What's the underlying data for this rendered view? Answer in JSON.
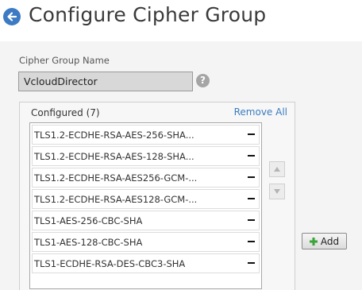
{
  "header": {
    "title": "Configure Cipher Group",
    "back_icon": "back-arrow-icon"
  },
  "form": {
    "name_label": "Cipher Group Name",
    "name_value": "VcloudDirector",
    "help_icon": "help-icon",
    "help_glyph": "?"
  },
  "configured": {
    "header": "Configured (7)",
    "remove_all_label": "Remove All",
    "items": [
      {
        "label": "TLS1.2-ECDHE-RSA-AES-256-SHA..."
      },
      {
        "label": "TLS1.2-ECDHE-RSA-AES-128-SHA..."
      },
      {
        "label": "TLS1.2-ECDHE-RSA-AES256-GCM-..."
      },
      {
        "label": "TLS1.2-ECDHE-RSA-AES128-GCM-..."
      },
      {
        "label": "TLS1-AES-256-CBC-SHA"
      },
      {
        "label": "TLS1-AES-128-CBC-SHA"
      },
      {
        "label": "TLS1-ECDHE-RSA-DES-CBC3-SHA"
      }
    ]
  },
  "controls": {
    "move_up_icon": "triangle-up-icon",
    "move_down_icon": "triangle-down-icon",
    "add_label": "Add",
    "add_icon": "plus-icon"
  },
  "colors": {
    "accent": "#3d7ac4",
    "link": "#3a7cc0",
    "add_icon": "#3aa339"
  }
}
